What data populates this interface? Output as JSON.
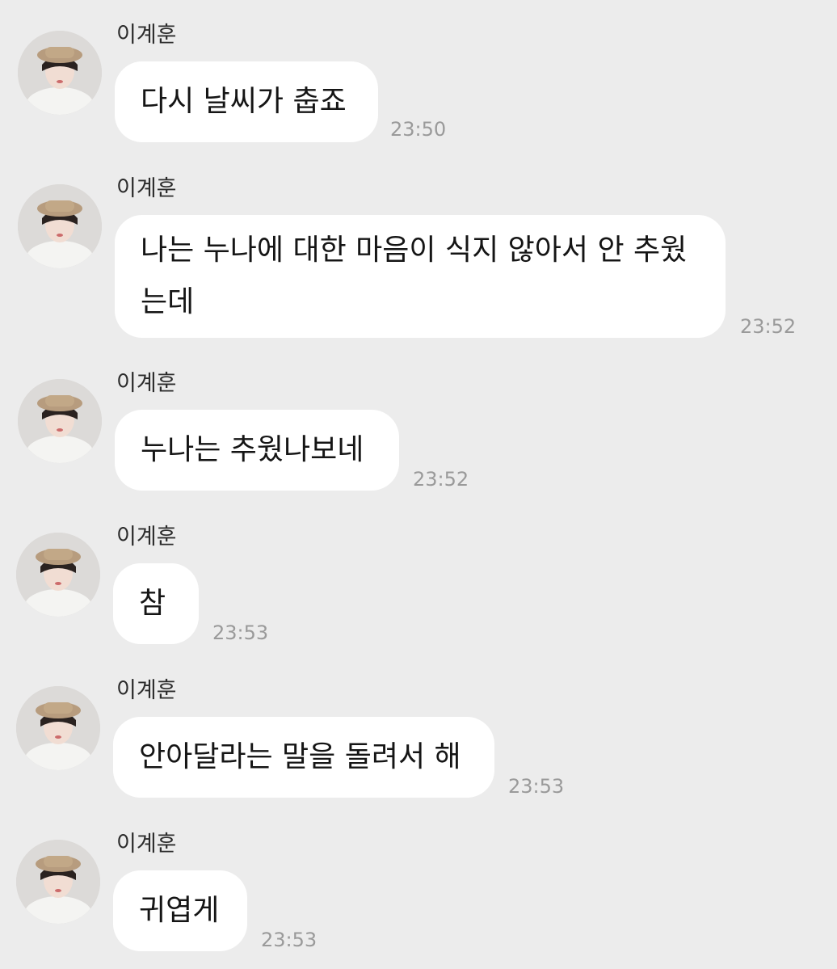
{
  "chat": {
    "messages": [
      {
        "sender": "이계훈",
        "text": "다시 날씨가 춥죠",
        "time": "23:50"
      },
      {
        "sender": "이계훈",
        "text_line1": "나는 누나에 대한 마음이 식지 않아서 안 추웠",
        "text_line2": "는데",
        "time": "23:52"
      },
      {
        "sender": "이계훈",
        "text": "누나는 추웠나보네",
        "time": "23:52"
      },
      {
        "sender": "이계훈",
        "text": "참",
        "time": "23:53"
      },
      {
        "sender": "이계훈",
        "text": "안아달라는 말을 돌려서 해",
        "time": "23:53"
      },
      {
        "sender": "이계훈",
        "text": "귀엽게",
        "time": "23:53"
      }
    ]
  }
}
